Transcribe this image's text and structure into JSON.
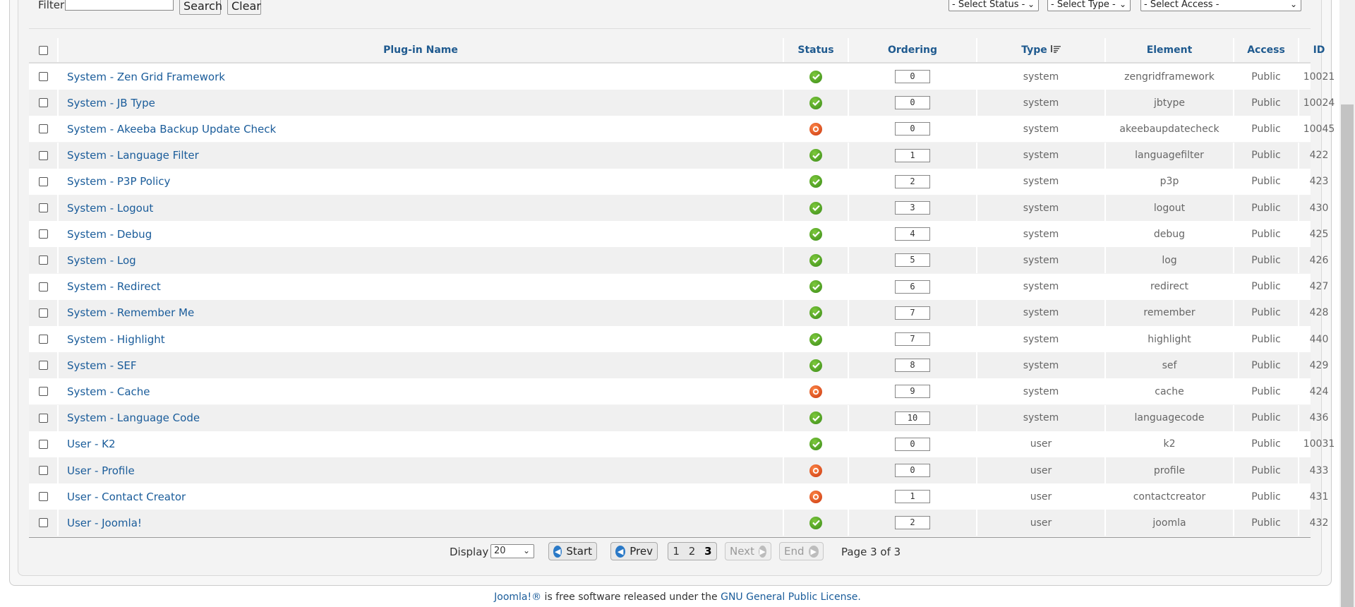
{
  "filter": {
    "label": "Filter:",
    "value": "",
    "search_label": "Search",
    "clear_label": "Clear",
    "status_select": "- Select Status -",
    "type_select": "- Select Type -",
    "access_select": "- Select Access -"
  },
  "columns": {
    "name": "Plug-in Name",
    "status": "Status",
    "ordering": "Ordering",
    "type": "Type",
    "element": "Element",
    "access": "Access",
    "id": "ID"
  },
  "rows": [
    {
      "name": "System - Zen Grid Framework",
      "status": "enabled",
      "ordering": "0",
      "type": "system",
      "element": "zengridframework",
      "access": "Public",
      "id": "10021"
    },
    {
      "name": "System - JB Type",
      "status": "enabled",
      "ordering": "0",
      "type": "system",
      "element": "jbtype",
      "access": "Public",
      "id": "10024"
    },
    {
      "name": "System - Akeeba Backup Update Check",
      "status": "disabled",
      "ordering": "0",
      "type": "system",
      "element": "akeebaupdatecheck",
      "access": "Public",
      "id": "10045"
    },
    {
      "name": "System - Language Filter",
      "status": "enabled",
      "ordering": "1",
      "type": "system",
      "element": "languagefilter",
      "access": "Public",
      "id": "422"
    },
    {
      "name": "System - P3P Policy",
      "status": "enabled",
      "ordering": "2",
      "type": "system",
      "element": "p3p",
      "access": "Public",
      "id": "423"
    },
    {
      "name": "System - Logout",
      "status": "enabled",
      "ordering": "3",
      "type": "system",
      "element": "logout",
      "access": "Public",
      "id": "430"
    },
    {
      "name": "System - Debug",
      "status": "enabled",
      "ordering": "4",
      "type": "system",
      "element": "debug",
      "access": "Public",
      "id": "425"
    },
    {
      "name": "System - Log",
      "status": "enabled",
      "ordering": "5",
      "type": "system",
      "element": "log",
      "access": "Public",
      "id": "426"
    },
    {
      "name": "System - Redirect",
      "status": "enabled",
      "ordering": "6",
      "type": "system",
      "element": "redirect",
      "access": "Public",
      "id": "427"
    },
    {
      "name": "System - Remember Me",
      "status": "enabled",
      "ordering": "7",
      "type": "system",
      "element": "remember",
      "access": "Public",
      "id": "428"
    },
    {
      "name": "System - Highlight",
      "status": "enabled",
      "ordering": "7",
      "type": "system",
      "element": "highlight",
      "access": "Public",
      "id": "440"
    },
    {
      "name": "System - SEF",
      "status": "enabled",
      "ordering": "8",
      "type": "system",
      "element": "sef",
      "access": "Public",
      "id": "429"
    },
    {
      "name": "System - Cache",
      "status": "disabled",
      "ordering": "9",
      "type": "system",
      "element": "cache",
      "access": "Public",
      "id": "424"
    },
    {
      "name": "System - Language Code",
      "status": "enabled",
      "ordering": "10",
      "type": "system",
      "element": "languagecode",
      "access": "Public",
      "id": "436"
    },
    {
      "name": "User - K2",
      "status": "enabled",
      "ordering": "0",
      "type": "user",
      "element": "k2",
      "access": "Public",
      "id": "10031"
    },
    {
      "name": "User - Profile",
      "status": "disabled",
      "ordering": "0",
      "type": "user",
      "element": "profile",
      "access": "Public",
      "id": "433"
    },
    {
      "name": "User - Contact Creator",
      "status": "disabled",
      "ordering": "1",
      "type": "user",
      "element": "contactcreator",
      "access": "Public",
      "id": "431"
    },
    {
      "name": "User - Joomla!",
      "status": "enabled",
      "ordering": "2",
      "type": "user",
      "element": "joomla",
      "access": "Public",
      "id": "432"
    }
  ],
  "pagination": {
    "display_label": "Display #",
    "display_value": "20",
    "start_label": "Start",
    "prev_label": "Prev",
    "next_label": "Next",
    "end_label": "End",
    "pages": [
      "1",
      "2",
      "3"
    ],
    "current_page": "3",
    "page_info": "Page 3 of 3"
  },
  "footer": {
    "joomla_link": "Joomla!®",
    "text": " is free software released under the ",
    "license_link": "GNU General Public License."
  },
  "colors": {
    "link": "#1a5c9a",
    "enabled": "#3a8a18",
    "disabled": "#c8340c"
  }
}
